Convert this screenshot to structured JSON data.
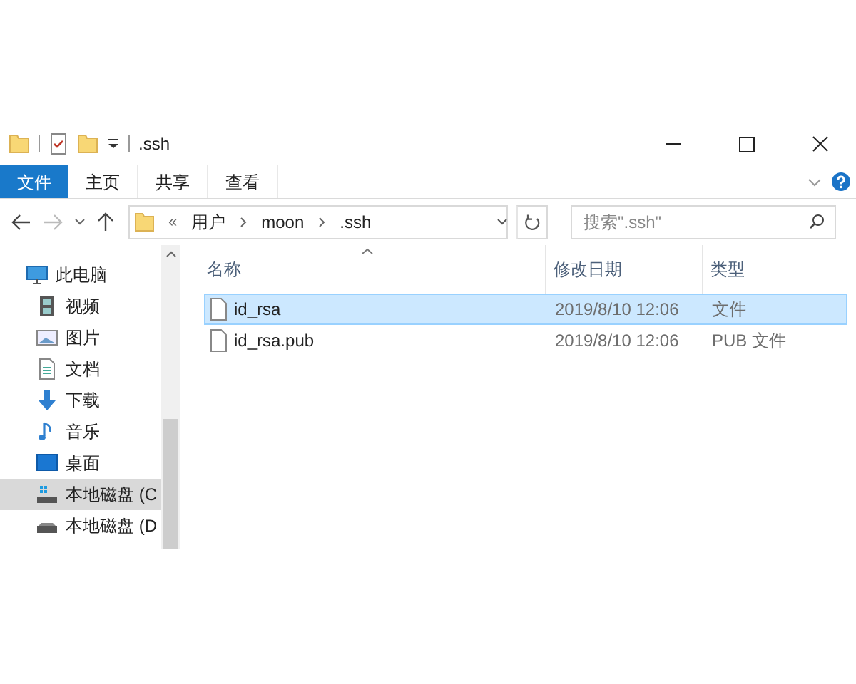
{
  "window": {
    "title": ".ssh"
  },
  "ribbon_tabs": [
    {
      "label": "文件",
      "kind": "file",
      "selected": false
    },
    {
      "label": "主页",
      "kind": "tab",
      "selected": false
    },
    {
      "label": "共享",
      "kind": "tab",
      "selected": false
    },
    {
      "label": "查看",
      "kind": "tab",
      "selected": false
    }
  ],
  "address_bar": {
    "overflow": "«",
    "path": [
      "用户",
      "moon",
      ".ssh"
    ]
  },
  "search": {
    "placeholder": "搜索\".ssh\""
  },
  "nav_pane": [
    {
      "label": "此电脑",
      "kind": "pc",
      "selected": false
    },
    {
      "label": "视频",
      "kind": "video",
      "selected": false
    },
    {
      "label": "图片",
      "kind": "pictures",
      "selected": false
    },
    {
      "label": "文档",
      "kind": "documents",
      "selected": false
    },
    {
      "label": "下载",
      "kind": "downloads",
      "selected": false
    },
    {
      "label": "音乐",
      "kind": "music",
      "selected": false
    },
    {
      "label": "桌面",
      "kind": "desktop",
      "selected": false
    },
    {
      "label": "本地磁盘 (C",
      "kind": "systemdrive",
      "selected": true
    },
    {
      "label": "本地磁盘 (D",
      "kind": "drive",
      "selected": false
    }
  ],
  "file_list": {
    "columns": [
      "名称",
      "修改日期",
      "类型"
    ],
    "rows": [
      {
        "name": "id_rsa",
        "modified": "2019/8/10 12:06",
        "type": "文件",
        "selected": true
      },
      {
        "name": "id_rsa.pub",
        "modified": "2019/8/10 12:06",
        "type": "PUB 文件",
        "selected": false
      }
    ]
  }
}
